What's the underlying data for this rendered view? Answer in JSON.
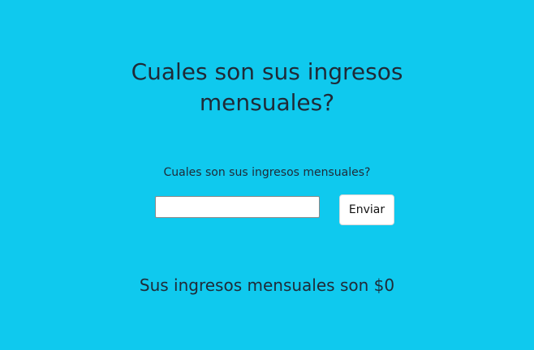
{
  "form": {
    "title": "Cuales son sus ingresos mensuales?",
    "prompt": "Cuales son sus ingresos mensuales?",
    "input_value": "",
    "input_placeholder": "",
    "submit_label": "Enviar"
  },
  "result": {
    "text": "Sus ingresos mensuales son $0"
  },
  "colors": {
    "background": "#0fc9ee",
    "text": "#1f2a37",
    "button_bg": "#ffffff"
  }
}
